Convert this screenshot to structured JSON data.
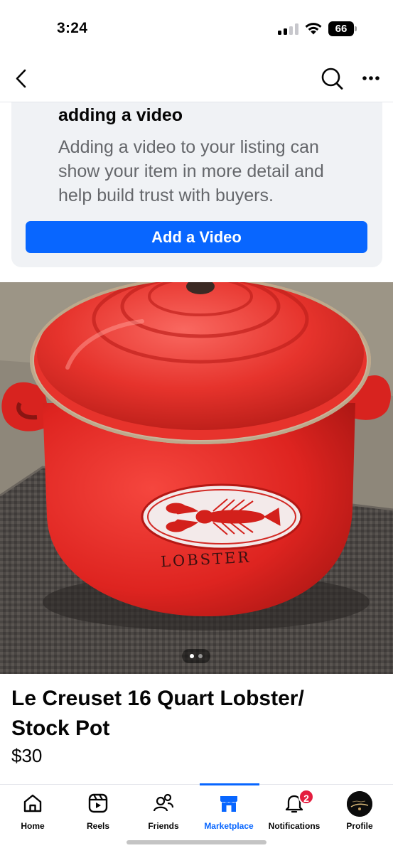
{
  "status_bar": {
    "time": "3:24",
    "battery_level": "66",
    "icons": [
      "cellular-signal-icon",
      "wifi-icon",
      "battery-icon"
    ]
  },
  "header": {
    "icons": [
      "back-chevron-icon",
      "search-icon",
      "more-horizontal-icon"
    ]
  },
  "video_prompt": {
    "title": "adding a video",
    "description": "Adding a video to your listing can show your item in more detail and help build trust with buyers.",
    "button_label": "Add a Video",
    "button_color": "#0866ff"
  },
  "photo": {
    "pot_lettering": "LOBSTER",
    "carousel_total": 2,
    "carousel_current": 1
  },
  "listing": {
    "title": "Le Creuset 16 Quart Lobster/ Stock Pot",
    "price": "$30"
  },
  "tab_bar": {
    "active_color": "#0866ff",
    "tabs": [
      {
        "label": "Home",
        "icon": "home-icon"
      },
      {
        "label": "Reels",
        "icon": "reels-icon"
      },
      {
        "label": "Friends",
        "icon": "friends-icon"
      },
      {
        "label": "Marketplace",
        "icon": "marketplace-icon",
        "active": true
      },
      {
        "label": "Notifications",
        "icon": "bell-icon",
        "badge": "2"
      },
      {
        "label": "Profile",
        "icon": "avatar"
      }
    ]
  }
}
